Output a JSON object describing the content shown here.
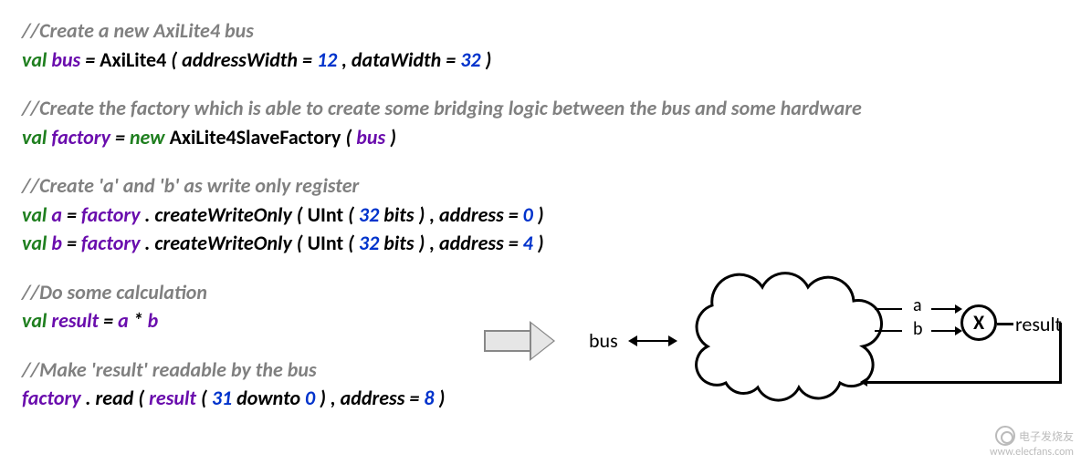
{
  "code": {
    "l1_comment": "//Create a new AxiLite4 bus",
    "l2": {
      "kw": "val",
      "id": "bus",
      "eq": " = ",
      "cls": "AxiLite4",
      "open": "(",
      "p1": "addressWidth = ",
      "n1": "12",
      "sep": ", ",
      "p2": "dataWidth = ",
      "n2": "32",
      "close": ")"
    },
    "l3_comment": "//Create the factory which is able to create some bridging logic between the bus and some hardware",
    "l4": {
      "kw": "val",
      "id": "factory",
      "eq": " = ",
      "kw2": "new",
      "sp": " ",
      "cls": "AxiLite4SlaveFactory",
      "open": "(",
      "arg": "bus",
      "close": ")"
    },
    "l5_comment": "//Create 'a' and 'b' as write only register",
    "l6": {
      "kw": "val",
      "id": "a",
      "eq": " = ",
      "fac": "factory",
      "dot": ".",
      "fn": "createWriteOnly",
      "open": "(",
      "t": "UInt",
      "op2": "(",
      "n": "32",
      "bits": " bits",
      "cp2": ")",
      "sep": ", ",
      "addr": "address = ",
      "na": "0",
      "close": ")"
    },
    "l7": {
      "kw": "val",
      "id": "b",
      "eq": " = ",
      "fac": "factory",
      "dot": ".",
      "fn": "createWriteOnly",
      "open": "(",
      "t": "UInt",
      "op2": "(",
      "n": "32",
      "bits": " bits",
      "cp2": ")",
      "sep": ", ",
      "addr": "address = ",
      "na": "4",
      "close": ")"
    },
    "l8_comment": "//Do some calculation",
    "l9": {
      "kw": "val",
      "id": "result",
      "eq": " = ",
      "a": "a",
      "op": " * ",
      "b": "b"
    },
    "l10_comment": "//Make 'result' readable by the bus",
    "l11": {
      "fac": "factory",
      "dot": ".",
      "fn": "read",
      "open": "(",
      "res": "result",
      "op2": "(",
      "n1": "31",
      "dto": " downto ",
      "n2": "0",
      "cp2": ")",
      "sep": ", ",
      "addr": "address = ",
      "na": "8",
      "close": ")"
    }
  },
  "diagram": {
    "bus": "bus",
    "a": "a",
    "b": "b",
    "mul": "X",
    "result": "result"
  },
  "watermark": {
    "name": "电子发烧友",
    "url": "www.elecfans.com"
  }
}
